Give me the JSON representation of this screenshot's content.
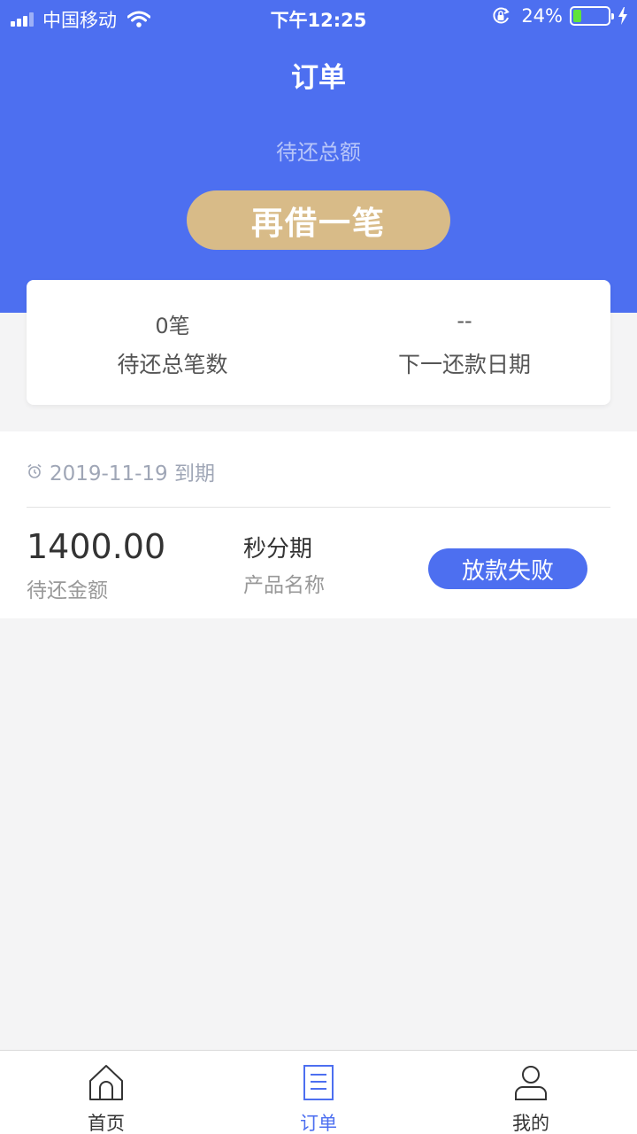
{
  "status_bar": {
    "carrier": "中国移动",
    "time": "下午12:25",
    "battery": "24%",
    "battery_level": 0.24
  },
  "header": {
    "title": "订单",
    "subtitle": "待还总额",
    "borrow_button": "再借一笔"
  },
  "summary": {
    "count_value": "0笔",
    "count_label": "待还总笔数",
    "next_date_value": "--",
    "next_date_label": "下一还款日期"
  },
  "order": {
    "due_text": "2019-11-19 到期",
    "amount": "1400.00",
    "amount_label": "待还金额",
    "product": "秒分期",
    "product_label": "产品名称",
    "status": "放款失败"
  },
  "tabbar": {
    "items": [
      {
        "label": "首页",
        "icon": "home-icon"
      },
      {
        "label": "订单",
        "icon": "orders-icon",
        "active": true
      },
      {
        "label": "我的",
        "icon": "profile-icon"
      }
    ]
  },
  "colors": {
    "primary": "#4d6ff0",
    "gold": "#d8bb88",
    "battery_green": "#5fe33b"
  }
}
